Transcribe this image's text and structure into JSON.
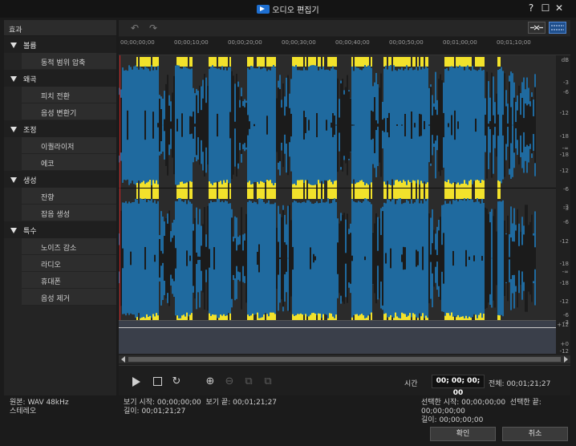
{
  "window": {
    "title": "오디오 편집기",
    "help": "?",
    "maximize": "☐",
    "close": "✕"
  },
  "effects": {
    "header": "효과",
    "categories": [
      {
        "label": "볼륨",
        "items": [
          "동적 범위 압축"
        ]
      },
      {
        "label": "왜곡",
        "items": [
          "피치 전환",
          "음성 변환기"
        ]
      },
      {
        "label": "조정",
        "items": [
          "이퀄라이저",
          "에코"
        ]
      },
      {
        "label": "생성",
        "items": [
          "잔향",
          "잡음 생성"
        ]
      },
      {
        "label": "특수",
        "items": [
          "노이즈 감소",
          "라디오",
          "휴대폰",
          "음성 제거"
        ]
      }
    ]
  },
  "ruler": {
    "ticks": [
      "00;00;00;00",
      "00;00;10;00",
      "00;00;20;00",
      "00;00;30;00",
      "00;00;40;00",
      "00;00;50;00",
      "00;01;00;00",
      "00;01;10;00"
    ]
  },
  "db_scale": {
    "unit": "dB",
    "upper": [
      "-3",
      "-6",
      "-12",
      "-18",
      "-∞",
      "-18",
      "-12",
      "-6",
      "-3"
    ],
    "lower": [
      "-3",
      "-6",
      "-12",
      "-18",
      "-∞",
      "-18",
      "-12",
      "-6",
      "-3"
    ],
    "envelope": [
      "+12",
      "+0",
      "-12"
    ]
  },
  "colors": {
    "wave": "#1f6a9f",
    "wave_peak": "#1b1b1b",
    "clip": "#f2e22b",
    "playhead": "#d32222"
  },
  "transport": {
    "time_label": "시간",
    "current_time": "00; 00; 00; 00",
    "total": "전체: 00;01;21;27"
  },
  "info": {
    "source": "원본: WAV 48kHz",
    "channels": "스테레오",
    "view_start": "보기 시작: 00;00;00;00",
    "view_end": "보기 끝: 00;01;21;27",
    "length": "길이: 00;01;21;27",
    "sel_start": "선택한 시작: 00;00;00;00",
    "sel_end": "선택한 끝: 00;00;00;00",
    "sel_length": "길이: 00;00;00;00"
  },
  "buttons": {
    "ok": "확인",
    "cancel": "취소"
  }
}
